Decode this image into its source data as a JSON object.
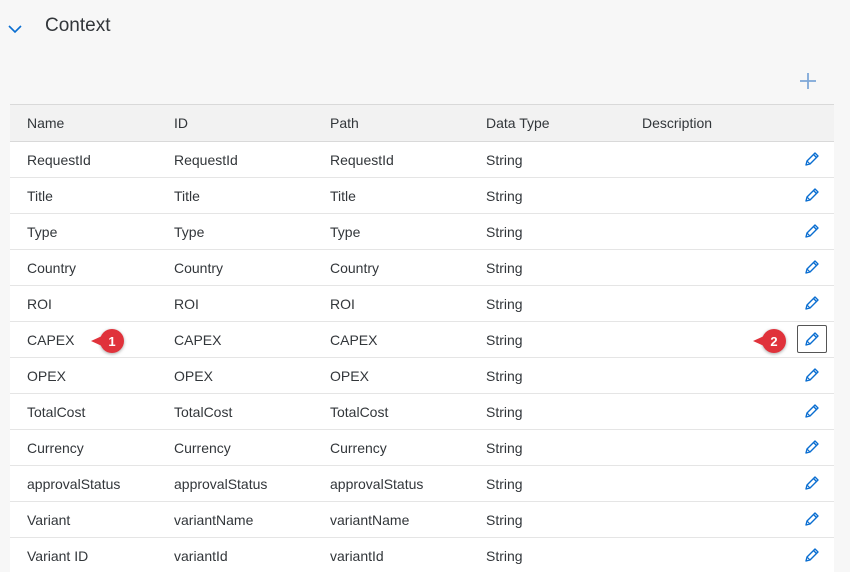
{
  "section": {
    "title": "Context",
    "chevron_icon": "chevron-down-icon",
    "add_icon": "plus-icon"
  },
  "colors": {
    "accent": "#0a6ed1",
    "callout": "#e0323b",
    "header_bg": "#f2f2f2",
    "row_bg": "#ffffff",
    "page_bg": "#f7f7f7"
  },
  "table": {
    "columns": [
      "Name",
      "ID",
      "Path",
      "Data Type",
      "Description"
    ],
    "edit_icon": "pencil-icon",
    "rows": [
      {
        "name": "RequestId",
        "id": "RequestId",
        "path": "RequestId",
        "type": "String",
        "description": ""
      },
      {
        "name": "Title",
        "id": "Title",
        "path": "Title",
        "type": "String",
        "description": ""
      },
      {
        "name": "Type",
        "id": "Type",
        "path": "Type",
        "type": "String",
        "description": ""
      },
      {
        "name": "Country",
        "id": "Country",
        "path": "Country",
        "type": "String",
        "description": ""
      },
      {
        "name": "ROI",
        "id": "ROI",
        "path": "ROI",
        "type": "String",
        "description": ""
      },
      {
        "name": "CAPEX",
        "id": "CAPEX",
        "path": "CAPEX",
        "type": "String",
        "description": ""
      },
      {
        "name": "OPEX",
        "id": "OPEX",
        "path": "OPEX",
        "type": "String",
        "description": ""
      },
      {
        "name": "TotalCost",
        "id": "TotalCost",
        "path": "TotalCost",
        "type": "String",
        "description": ""
      },
      {
        "name": "Currency",
        "id": "Currency",
        "path": "Currency",
        "type": "String",
        "description": ""
      },
      {
        "name": "approvalStatus",
        "id": "approvalStatus",
        "path": "approvalStatus",
        "type": "String",
        "description": ""
      },
      {
        "name": "Variant",
        "id": "variantName",
        "path": "variantName",
        "type": "String",
        "description": ""
      },
      {
        "name": "Variant ID",
        "id": "variantId",
        "path": "variantId",
        "type": "String",
        "description": ""
      }
    ]
  },
  "callouts": [
    {
      "label": "1"
    },
    {
      "label": "2"
    }
  ]
}
